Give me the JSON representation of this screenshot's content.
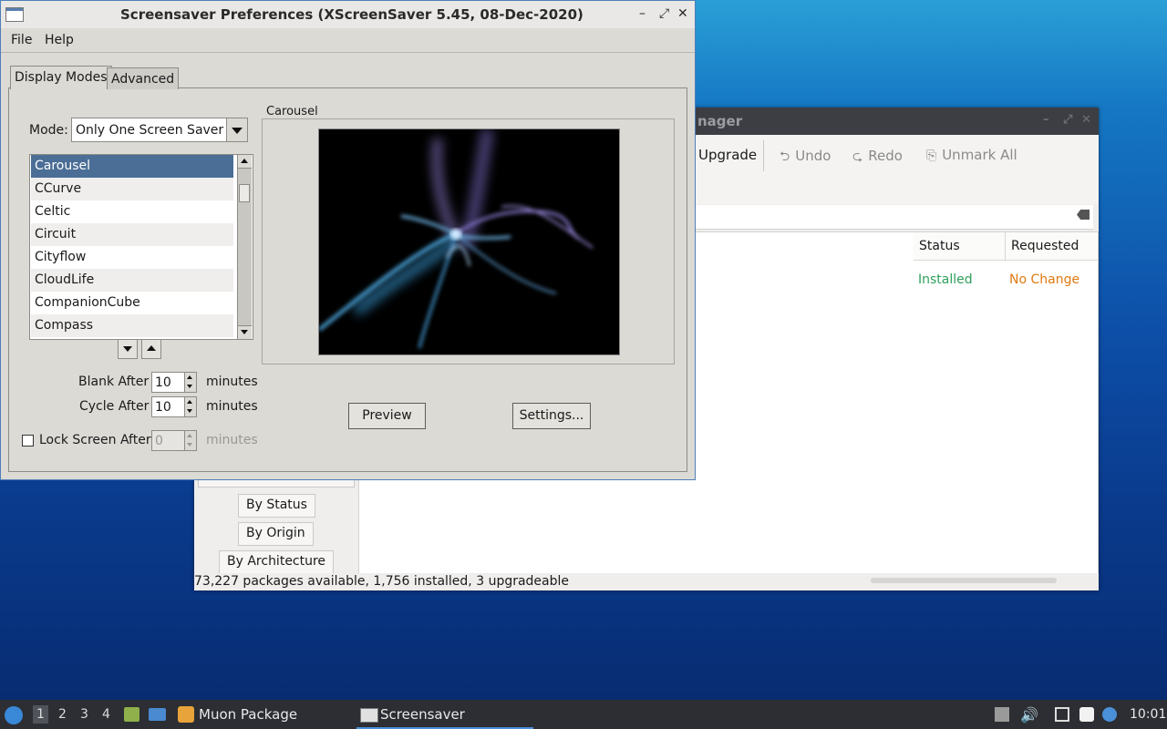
{
  "muon": {
    "title_fragment": "nager",
    "toolbar": {
      "upgrade_label": "Upgrade",
      "undo_label": "Undo",
      "redo_label": "Redo",
      "unmark_all_label": "Unmark All"
    },
    "columns": [
      "Status",
      "Requested"
    ],
    "row": {
      "status": "Installed",
      "requested": "No Change"
    },
    "filters": [
      "By Status",
      "By Origin",
      "By Architecture"
    ],
    "status_bar": "73,227 packages available, 1,756 installed, 3 upgradeable",
    "colors": {
      "installed": "#2e9f5b",
      "no_change": "#e07a10"
    }
  },
  "xss": {
    "title": "Screensaver Preferences  (XScreenSaver 5.45, 08-Dec-2020)",
    "menu": {
      "file": "File",
      "help": "Help"
    },
    "tabs": {
      "display_modes": "Display Modes",
      "advanced": "Advanced"
    },
    "mode_label": "Mode:",
    "mode_value": "Only One Screen Saver",
    "savers": [
      "Carousel",
      "CCurve",
      "Celtic",
      "Circuit",
      "Cityflow",
      "CloudLife",
      "CompanionCube",
      "Compass"
    ],
    "selected_saver": "Carousel",
    "preview_title": "Carousel",
    "blank_after": {
      "label": "Blank After",
      "value": "10",
      "unit": "minutes"
    },
    "cycle_after": {
      "label": "Cycle After",
      "value": "10",
      "unit": "minutes"
    },
    "lock_after": {
      "label": "Lock Screen After",
      "value": "0",
      "unit": "minutes"
    },
    "preview_button": "Preview",
    "settings_button": "Settings..."
  },
  "taskbar": {
    "workspaces": [
      "1",
      "2",
      "3",
      "4"
    ],
    "apps": [
      "Muon Package Manager",
      "Screensaver Preferen..."
    ],
    "clock": "10:01"
  }
}
